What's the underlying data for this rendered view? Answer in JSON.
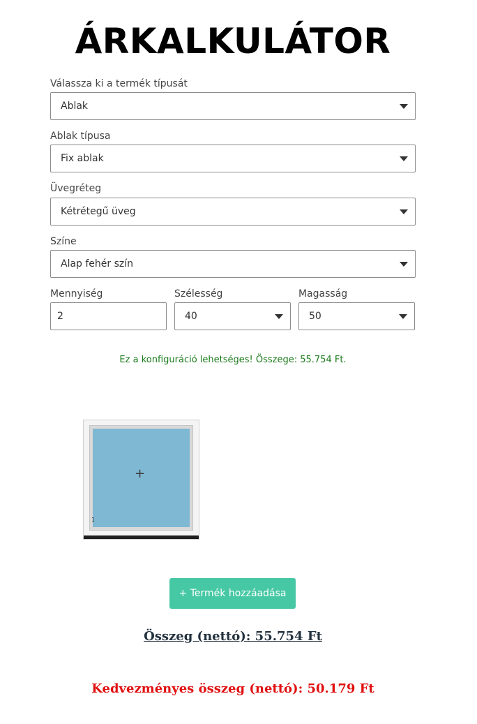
{
  "page": {
    "title": "ÁRKALKULÁTOR"
  },
  "product_type": {
    "label": "Válassza ki a termék típusát",
    "value": "Ablak"
  },
  "window_type": {
    "label": "Ablak típusa",
    "value": "Fix ablak"
  },
  "glazing": {
    "label": "Üvegréteg",
    "value": "Kétrétegű üveg"
  },
  "color": {
    "label": "Színe",
    "value": "Alap fehér szín"
  },
  "quantity": {
    "label": "Mennyiség",
    "value": "2"
  },
  "width": {
    "label": "Szélesség",
    "value": "40"
  },
  "height": {
    "label": "Magasság",
    "value": "50"
  },
  "status_message": "Ez a konfiguráció lehetséges! Összege: 55.754 Ft.",
  "preview": {
    "plus_symbol": "+",
    "sash_number": "1",
    "glass_color": "#7fb8d3"
  },
  "add_button_label": "+ Termék hozzáadása",
  "total_net": "Összeg (nettó): 55.754 Ft",
  "discounted_net": "Kedvezményes összeg (nettó): 50.179 Ft",
  "colors": {
    "accent": "#47c8a4",
    "success": "#1a7a1a",
    "discount": "#e01010"
  }
}
